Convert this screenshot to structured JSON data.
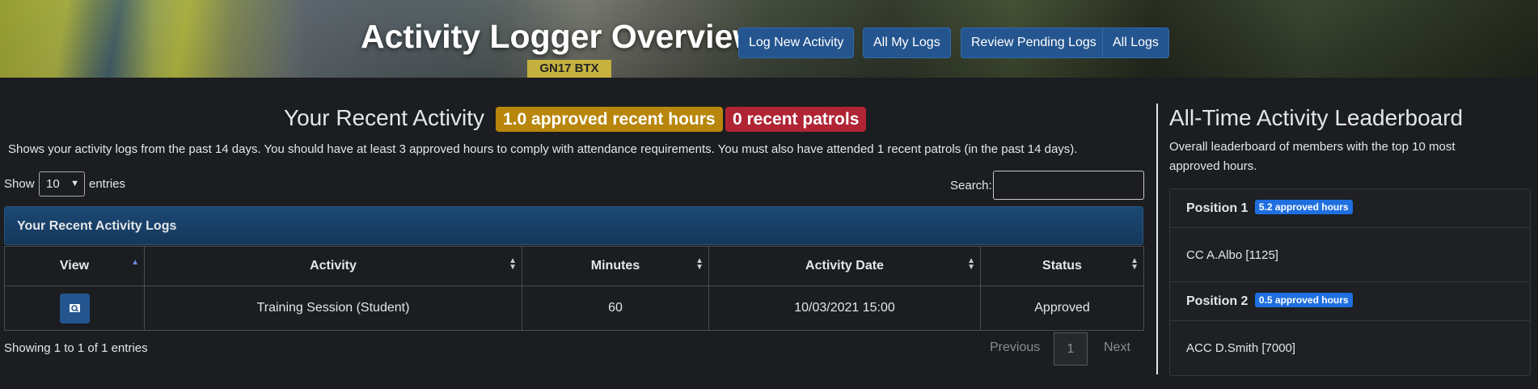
{
  "header": {
    "title": "Activity Logger Overview",
    "nav": [
      {
        "label": "Log New Activity"
      },
      {
        "label": "All My Logs"
      },
      {
        "label": "Review Pending Logs"
      },
      {
        "label": "All Logs"
      }
    ],
    "plate_text": "GN17 BTX"
  },
  "recent": {
    "title": "Your Recent Activity",
    "hours_badge": "1.0 approved recent hours",
    "patrols_badge": "0 recent patrols",
    "description": "Shows your activity logs from the past 14 days. You should have at least 3 approved hours to comply with attendance requirements. You must also have attended 1 recent patrols (in the past 14 days).",
    "show_label": "Show",
    "entries_value": "10",
    "entries_label": "entries",
    "search_label": "Search:",
    "search_value": "",
    "table_caption": "Your Recent Activity Logs",
    "columns": [
      "View",
      "Activity",
      "Minutes",
      "Activity Date",
      "Status"
    ],
    "rows": [
      {
        "activity": "Training Session (Student)",
        "minutes": "60",
        "date": "10/03/2021 15:00",
        "status": "Approved"
      }
    ],
    "info": "Showing 1 to 1 of 1 entries",
    "pager": {
      "previous": "Previous",
      "page": "1",
      "next": "Next"
    }
  },
  "leaderboard": {
    "title": "All-Time Activity Leaderboard",
    "description": "Overall leaderboard of members with the top 10 most approved hours.",
    "entries": [
      {
        "position": "Position 1",
        "hours": "5.2 approved hours",
        "member": "CC A.Albo [1125]"
      },
      {
        "position": "Position 2",
        "hours": "0.5 approved hours",
        "member": "ACC D.Smith [7000]"
      }
    ]
  },
  "colors": {
    "hours_badge": "#b8860b",
    "patrols_badge": "#b02434",
    "primary_button": "#24558f",
    "pill": "#1f6fe0"
  }
}
